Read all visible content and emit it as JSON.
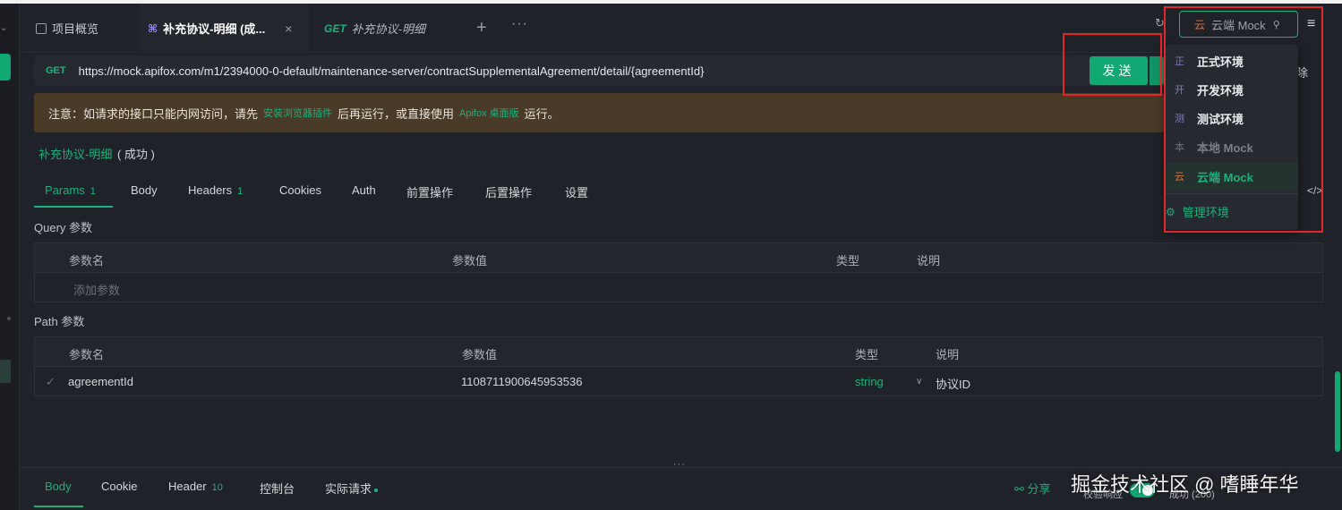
{
  "tabs": {
    "overview_label": "项目概览",
    "active_label": "补充协议-明细 (成...",
    "close_glyph": "×",
    "second_method": "GET",
    "second_label": "补充协议-明细",
    "plus_glyph": "+",
    "more_glyph": "···"
  },
  "request": {
    "method": "GET",
    "url": "https://mock.apifox.com/m1/2394000-0-default/maintenance-server/contractSupplementalAgreement/detail/{agreementId}",
    "send_label": "发送",
    "delete_label": "除"
  },
  "notice": {
    "prefix": "注意：如请求的接口只能内网访问，请先",
    "link1": "安装浏览器插件",
    "middle": "后再运行，或直接使用",
    "link2": "Apifox 桌面版",
    "suffix": "运行。"
  },
  "breadcrumb": {
    "name": "补充协议-明细",
    "status": "( 成功 )"
  },
  "subtabs": [
    {
      "label": "Params",
      "count": "1"
    },
    {
      "label": "Body"
    },
    {
      "label": "Headers",
      "count": "1"
    },
    {
      "label": "Cookies"
    },
    {
      "label": "Auth"
    },
    {
      "label": "前置操作"
    },
    {
      "label": "后置操作"
    },
    {
      "label": "设置"
    }
  ],
  "query": {
    "title": "Query 参数",
    "headers": [
      "参数名",
      "参数值",
      "类型",
      "说明"
    ],
    "placeholder": "添加参数"
  },
  "path": {
    "title": "Path 参数",
    "headers": [
      "参数名",
      "参数值",
      "类型",
      "说明"
    ],
    "rows": [
      {
        "name": "agreementId",
        "value": "1108711900645953536",
        "type": "string",
        "desc": "协议ID"
      }
    ]
  },
  "bottom": {
    "tabs": [
      {
        "label": "Body"
      },
      {
        "label": "Cookie"
      },
      {
        "label": "Header",
        "count": "10"
      },
      {
        "label": "控制台"
      },
      {
        "label": "实际请求"
      }
    ],
    "share_label": "分享",
    "validate_label": "校验响应",
    "status": "成功 (200)",
    "watermark": "掘金技术社区 @ 嗜睡年华"
  },
  "env": {
    "current_badge": "云",
    "current": "云端 Mock",
    "items": [
      {
        "badge": "正",
        "label": "正式环境",
        "badge_color": "#7b7fc4"
      },
      {
        "badge": "开",
        "label": "开发环境",
        "badge_color": "#7b7fc4"
      },
      {
        "badge": "测",
        "label": "测试环境",
        "badge_color": "#7b7fc4"
      },
      {
        "badge": "本",
        "label": "本地 Mock",
        "badge_color": "#6c7078"
      },
      {
        "badge": "云",
        "label": "云端 Mock",
        "badge_color": "#e0703a"
      }
    ],
    "manage_label": "管理环境"
  },
  "colors": {
    "accent": "#12a874",
    "highlight_box": "#e3262c",
    "notice_bg": "#4a3a28"
  }
}
